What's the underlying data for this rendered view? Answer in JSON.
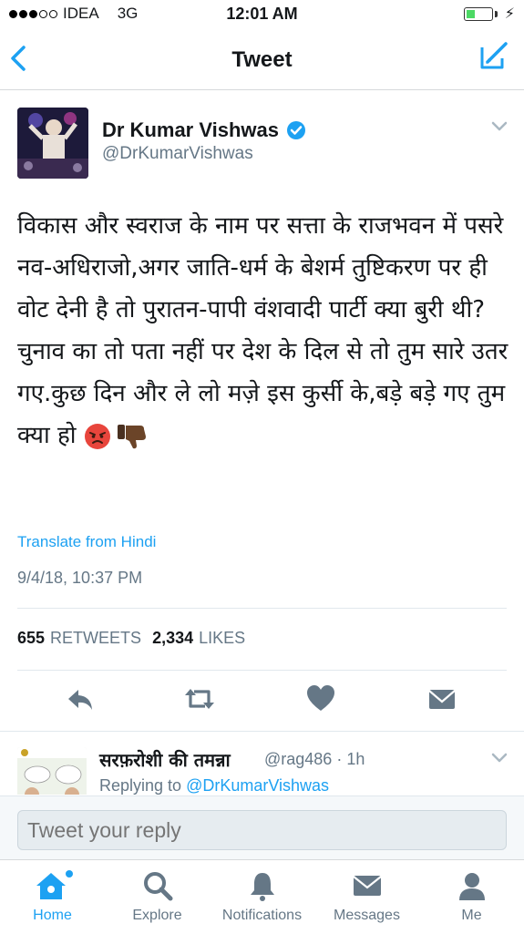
{
  "status": {
    "carrier": "IDEA",
    "network": "3G",
    "time": "12:01 AM"
  },
  "nav": {
    "title": "Tweet"
  },
  "tweet": {
    "author_name": "Dr Kumar Vishwas",
    "handle": "@DrKumarVishwas",
    "text": "विकास और स्वराज के नाम पर सत्ता के राजभवन में पसरे नव-अधिराजो,अगर जाति-धर्म के बेशर्म तुष्टिकरण पर ही वोट देनी है तो पुरातन-पापी वंशवादी पार्टी क्या बुरी थी?चुनाव का तो पता नहीं पर देश के दिल से तो तुम सारे उतर गए.कुछ दिन और ले लो मज़े इस कुर्सी के,बड़े बड़े गए तुम क्या हो",
    "translate_link": "Translate from Hindi",
    "timestamp": "9/4/18, 10:37 PM",
    "retweets_count": "655",
    "retweets_label": "RETWEETS",
    "likes_count": "2,334",
    "likes_label": "LIKES",
    "emojis": [
      "angry-face-icon",
      "thumbs-down-icon"
    ]
  },
  "reply": {
    "name": "सरफ़रोशी की तमन्ना",
    "handle": "@rag486 · 1h",
    "replying_prefix": "Replying to ",
    "replying_to": "@DrKumarVishwas"
  },
  "composer": {
    "placeholder": "Tweet your reply"
  },
  "tabs": [
    {
      "label": "Home",
      "icon": "home-icon",
      "active": true
    },
    {
      "label": "Explore",
      "icon": "search-icon",
      "active": false
    },
    {
      "label": "Notifications",
      "icon": "bell-icon",
      "active": false
    },
    {
      "label": "Messages",
      "icon": "envelope-icon",
      "active": false
    },
    {
      "label": "Me",
      "icon": "person-icon",
      "active": false
    }
  ],
  "colors": {
    "accent": "#1da1f2",
    "muted": "#657786",
    "text": "#14171a"
  }
}
